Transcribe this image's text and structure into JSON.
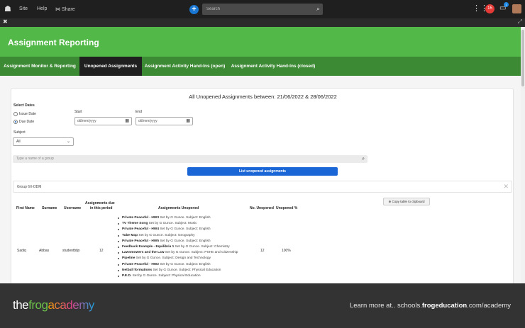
{
  "topbar": {
    "site_label": "Site",
    "help_label": "Help",
    "share_label": "Share",
    "search_placeholder": "Search",
    "badge_count": "15",
    "notif_count": "1"
  },
  "header": {
    "title": "Assignment Reporting"
  },
  "tabs": [
    {
      "label": "Assignment Monitor & Reporting"
    },
    {
      "label": "Unopened Assignments"
    },
    {
      "label": "Assignment Activity Hand-Ins (open)"
    },
    {
      "label": "Assignment Activity Hand-Ins (closed)"
    }
  ],
  "report": {
    "title": "All Unopened Assignments between: 21/06/2022 & 28/06/2022",
    "select_dates_label": "Select Dates",
    "issue_date_label": "Issue Date",
    "due_date_label": "Due Date",
    "start_label": "Start",
    "end_label": "End",
    "date_placeholder": "dd/mm/yyyy",
    "subject_label": "Subject",
    "subject_value": "All",
    "group_search_placeholder": "Type a name of a group",
    "list_button": "List unopened assignments",
    "group_text": "Group 6X-DDM",
    "copy_button": "Copy table to clipboard"
  },
  "table": {
    "headers": {
      "first_name": "First Name",
      "surname": "Surname",
      "username": "Username",
      "due_line1": "Assignments due",
      "due_line2": "in this period",
      "unopened": "Assignments Unopened",
      "no_unopened": "No. Unopened",
      "unopened_pct": "Unopened %"
    },
    "row": {
      "first_name": "Sadiq",
      "surname": "Abbas",
      "username": "studentbtjo",
      "due": "12",
      "no_unopened": "12",
      "pct": "100%"
    },
    "assignments": [
      {
        "name": "Private Peaceful - HW3",
        "info": " Set by G Gunce. Subject: English"
      },
      {
        "name": "TV Theme Song",
        "info": " Set by G Gunce. Subject: Music"
      },
      {
        "name": "Private Peaceful - HW4",
        "info": " Set by G Gunce. Subject: English"
      },
      {
        "name": "Tube Map",
        "info": " Set by G Gunce. Subject: Geography"
      },
      {
        "name": "Private Peaceful - HW5",
        "info": " Set by G Gunce. Subject: English"
      },
      {
        "name": "Feedback Example - Equilibria 1",
        "info": " Set by G Gunce. Subject: Chemistry"
      },
      {
        "name": "Lawnmowers and the Law",
        "info": " Set by G Gunce. Subject: PSHE and Citizenship"
      },
      {
        "name": "Pipeline",
        "info": " Set by G Gunce. Subject: Design and Technology"
      },
      {
        "name": "Private Peaceful - HW2",
        "info": " Set by G Gunce. Subject: English"
      },
      {
        "name": "Netball formations",
        "info": " Set by G Gunce. Subject: Physical Education"
      },
      {
        "name": "P.E.D.",
        "info": " Set by G Gunce. Subject: Physical Education"
      }
    ]
  },
  "footer": {
    "brand_the": "the",
    "brand_frog": "frog",
    "brand_academy": "academy",
    "learn_prefix": "Learn more at.. schools.",
    "learn_bold": "frogeducation",
    "learn_suffix": ".com/academy"
  }
}
